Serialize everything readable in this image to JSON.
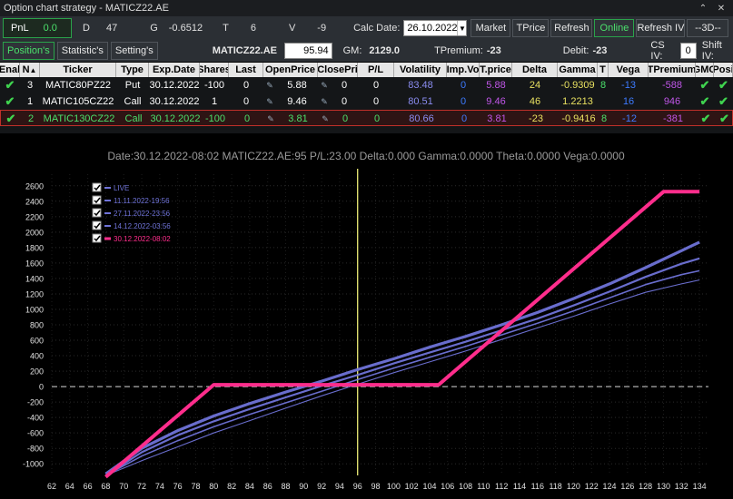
{
  "window": {
    "title": "Option chart strategy - MATICZ22.AE"
  },
  "greeks": {
    "pnl_label": "PnL",
    "pnl_value": "0.0",
    "d_label": "D",
    "d_value": "47",
    "g_label": "G",
    "g_value": "-0.6512",
    "t_label": "T",
    "t_value": "6",
    "v_label": "V",
    "v_value": "-9",
    "calc_label": "Calc Date:",
    "calc_date": "26.10.2022",
    "market": "Market",
    "tprice": "TPrice",
    "refresh": "Refresh",
    "online": "Online",
    "refresh_iv": "Refresh IV",
    "threed": "--3D--"
  },
  "toolbar": {
    "tab_positions": "Position's",
    "tab_statistics": "Statistic's",
    "tab_settings": "Setting's",
    "ticker": "MATICZ22.AE",
    "price": "95.94",
    "gm_label": "GM:",
    "gm_value": "2129.0",
    "tpremium_label": "TPremium:",
    "tpremium_value": "-23",
    "debit_label": "Debit:",
    "debit_value": "-23",
    "csiv_label": "CS IV:",
    "csiv_value": "0",
    "shiftiv_label": "Shift IV:"
  },
  "grid": {
    "headers": [
      "Enal",
      "N",
      "Ticker",
      "Type",
      "Exp.Date",
      "Shares",
      "Last",
      "OpenPrice",
      "ClosePri",
      "P/L",
      "Volatility",
      "Imp.Vo",
      "T.price",
      "Delta",
      "Gamma",
      "T",
      "Vega",
      "TPremium",
      "GMC",
      "Posi"
    ],
    "rows": [
      {
        "n": "3",
        "ticker": "MATIC80PZ22",
        "type": "Put",
        "exp": "30.12.2022",
        "shares": "-100",
        "last": "0",
        "open": "5.88",
        "close": "0",
        "pl": "0",
        "vol": "83.48",
        "impvol": "0",
        "tprice": "5.88",
        "delta": "24",
        "gamma": "-0.9309",
        "t": "8",
        "vega": "-13",
        "tprem": "-588"
      },
      {
        "n": "1",
        "ticker": "MATIC105CZ22",
        "type": "Call",
        "exp": "30.12.2022",
        "shares": "1",
        "last": "0",
        "open": "9.46",
        "close": "0",
        "pl": "0",
        "vol": "80.51",
        "impvol": "0",
        "tprice": "9.46",
        "delta": "46",
        "gamma": "1.2213",
        "t": "",
        "vega": "16",
        "tprem": "946"
      },
      {
        "n": "2",
        "ticker": "MATIC130CZ22",
        "type": "Call",
        "exp": "30.12.2022",
        "shares": "-100",
        "last": "0",
        "open": "3.81",
        "close": "0",
        "pl": "0",
        "vol": "80.66",
        "impvol": "0",
        "tprice": "3.81",
        "delta": "-23",
        "gamma": "-0.9416",
        "t": "8",
        "vega": "-12",
        "tprem": "-381"
      }
    ]
  },
  "chart": {
    "header": "Date:30.12.2022-08:02  MATICZ22.AE:95  P/L:23.00  Delta:0.000  Gamma:0.0000  Theta:0.0000  Vega:0.0000",
    "colors": {
      "live": "#6f73d8",
      "expiry": "#ff2d8c",
      "marker": "#ffff80"
    }
  },
  "chart_data": {
    "type": "line",
    "x_ticks": [
      62,
      64,
      66,
      68,
      70,
      72,
      74,
      76,
      78,
      80,
      82,
      84,
      86,
      88,
      90,
      92,
      94,
      96,
      98,
      100,
      102,
      104,
      106,
      108,
      110,
      112,
      114,
      116,
      118,
      120,
      122,
      124,
      126,
      128,
      130,
      132,
      134
    ],
    "y_ticks": [
      -1000,
      -800,
      -600,
      -400,
      -200,
      0,
      200,
      400,
      600,
      800,
      1000,
      1200,
      1400,
      1600,
      1800,
      2000,
      2200,
      2400,
      2600
    ],
    "xlim": [
      62,
      135
    ],
    "ylim": [
      -1150,
      2750
    ],
    "marker_x": 96,
    "series": [
      {
        "name": "LIVE",
        "x": [
          68,
          72,
          76,
          80,
          84,
          88,
          92,
          96,
          100,
          104,
          108,
          112,
          116,
          120,
          124,
          128,
          132,
          134
        ],
        "y": [
          -1130,
          -800,
          -570,
          -380,
          -220,
          -70,
          70,
          220,
          360,
          510,
          650,
          800,
          960,
          1140,
          1330,
          1540,
          1760,
          1870
        ]
      },
      {
        "name": "11.11.2022-19:56",
        "x": [
          68,
          72,
          76,
          80,
          84,
          88,
          92,
          96,
          100,
          104,
          108,
          112,
          116,
          120,
          124,
          128,
          132,
          134
        ],
        "y": [
          -1150,
          -850,
          -630,
          -450,
          -290,
          -140,
          10,
          150,
          300,
          440,
          580,
          730,
          880,
          1050,
          1230,
          1420,
          1590,
          1660
        ]
      },
      {
        "name": "27.11.2022-23:56",
        "x": [
          68,
          72,
          76,
          80,
          84,
          88,
          92,
          96,
          100,
          104,
          108,
          112,
          116,
          120,
          124,
          128,
          132,
          134
        ],
        "y": [
          -1150,
          -900,
          -700,
          -520,
          -360,
          -210,
          -60,
          90,
          240,
          380,
          520,
          670,
          820,
          980,
          1150,
          1320,
          1450,
          1500
        ]
      },
      {
        "name": "14.12.2022-03:56",
        "x": [
          68,
          72,
          76,
          80,
          84,
          88,
          92,
          96,
          100,
          104,
          108,
          112,
          116,
          120,
          124,
          128,
          132,
          134
        ],
        "y": [
          -1150,
          -960,
          -780,
          -600,
          -440,
          -280,
          -120,
          30,
          180,
          320,
          460,
          610,
          760,
          910,
          1070,
          1220,
          1330,
          1380
        ]
      },
      {
        "name": "30.12.2022-08:02",
        "x": [
          68,
          80,
          105,
          130,
          134
        ],
        "y": [
          -1170,
          23,
          23,
          2523,
          2523
        ]
      }
    ]
  }
}
